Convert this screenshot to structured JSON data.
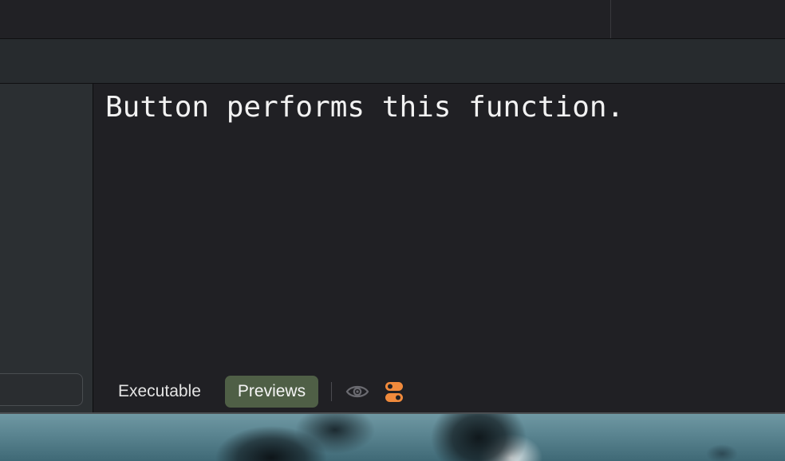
{
  "editor": {
    "preview_text": "Button performs this function."
  },
  "canvas_controls": {
    "executable_label": "Executable",
    "previews_label": "Previews",
    "selected_mode": "Previews",
    "icons": [
      "eye-icon",
      "selectable-toggle-icon"
    ]
  },
  "colors": {
    "selected_mode_background": "#4f5f46",
    "accent_orange": "#f08a3c",
    "canvas_background": "#202024"
  }
}
